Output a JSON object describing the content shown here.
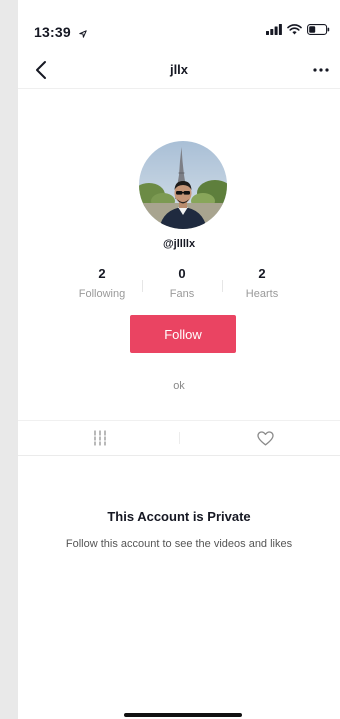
{
  "status_bar": {
    "time": "13:39",
    "icons": [
      "location-arrow-icon",
      "signal-icon",
      "wifi-icon",
      "battery-icon"
    ]
  },
  "nav": {
    "title": "jllx",
    "back_icon": "chevron-left-icon",
    "more_icon": "more-horizontal-icon"
  },
  "profile": {
    "handle": "@jllllx",
    "stats": [
      {
        "value": "2",
        "label": "Following"
      },
      {
        "value": "0",
        "label": "Fans"
      },
      {
        "value": "2",
        "label": "Hearts"
      }
    ],
    "follow_label": "Follow",
    "bio": "ok"
  },
  "tabs": {
    "icons": [
      "videos-grid-icon",
      "liked-heart-icon"
    ]
  },
  "private": {
    "title": "This Account is Private",
    "subtitle": "Follow this account to see the videos and likes"
  },
  "colors": {
    "accent": "#ea4462",
    "text": "#161823",
    "muted": "#9a9a9a"
  }
}
